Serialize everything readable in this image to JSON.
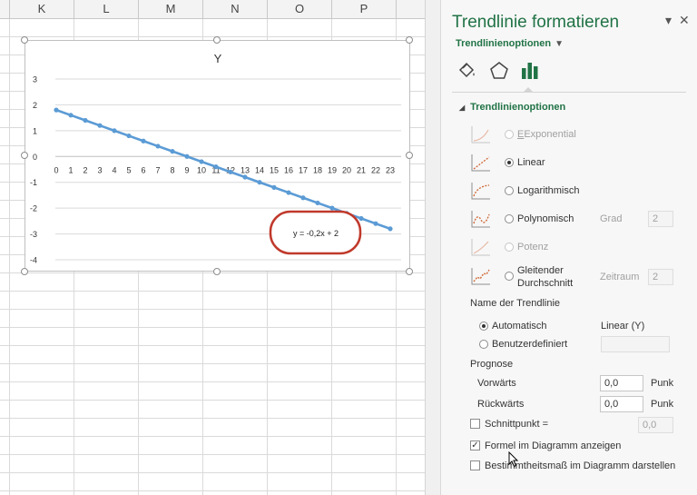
{
  "columns": [
    "K",
    "L",
    "M",
    "N",
    "O",
    "P"
  ],
  "chart_data": {
    "type": "line",
    "title": "Y",
    "xlabel": "",
    "ylabel": "",
    "x": [
      0,
      1,
      2,
      3,
      4,
      5,
      6,
      7,
      8,
      9,
      10,
      11,
      12,
      13,
      14,
      15,
      16,
      17,
      18,
      19,
      20,
      21,
      22,
      23
    ],
    "series": [
      {
        "name": "Y",
        "values": [
          1.8,
          1.6,
          1.4,
          1.2,
          1.0,
          0.8,
          0.6,
          0.4,
          0.2,
          0.0,
          -0.2,
          -0.4,
          -0.6,
          -0.8,
          -1.0,
          -1.2,
          -1.4,
          -1.6,
          -1.8,
          -2.0,
          -2.2,
          -2.4,
          -2.6,
          -2.8
        ],
        "color": "#5b9bd5"
      }
    ],
    "trendline": {
      "type": "linear",
      "equation": "y = -0,2x + 2"
    },
    "ylim": [
      -4,
      3
    ],
    "yticks": [
      "3",
      "2",
      "1",
      "0",
      "-1",
      "-2",
      "-3",
      "-4"
    ],
    "grid": true,
    "highlight_color": "#c0392b"
  },
  "pane": {
    "title": "Trendlinie formatieren",
    "close_glyph": "✕",
    "collapse_glyph": "▾",
    "options_dropdown": "Trendlinienoptionen",
    "tab_icons": [
      "fill-bucket-icon",
      "pentagon-icon",
      "bar-chart-icon"
    ],
    "section_header": "Trendlinienoptionen",
    "types": {
      "exponential": "Exponential",
      "linear": "Linear",
      "logarithmic": "Logarithmisch",
      "polynomial": "Polynomisch",
      "power": "Potenz",
      "moving_avg_line1": "Gleitender",
      "moving_avg_line2": "Durchschnitt"
    },
    "grad_label": "Grad",
    "grad_value": "2",
    "zeitraum_label": "Zeitraum",
    "zeitraum_value": "2",
    "name_header": "Name der Trendlinie",
    "name_auto": "Automatisch",
    "name_auto_value": "Linear (Y)",
    "name_custom": "Benutzerdefiniert",
    "name_custom_value": "",
    "forecast_header": "Prognose",
    "forward_label": "Vorwärts",
    "forward_value": "0,0",
    "backward_label": "Rückwärts",
    "backward_value": "0,0",
    "period_unit": "Punk",
    "intercept_label": "Schnittpunkt =",
    "intercept_value": "0,0",
    "show_equation_label": "Formel im Diagramm anzeigen",
    "show_equation_checked": true,
    "show_r2_label": "Bestimmtheitsmaß im Diagramm darstellen",
    "show_r2_checked": false,
    "accent": "#217346",
    "line_icon_color": "#d06a3a"
  }
}
